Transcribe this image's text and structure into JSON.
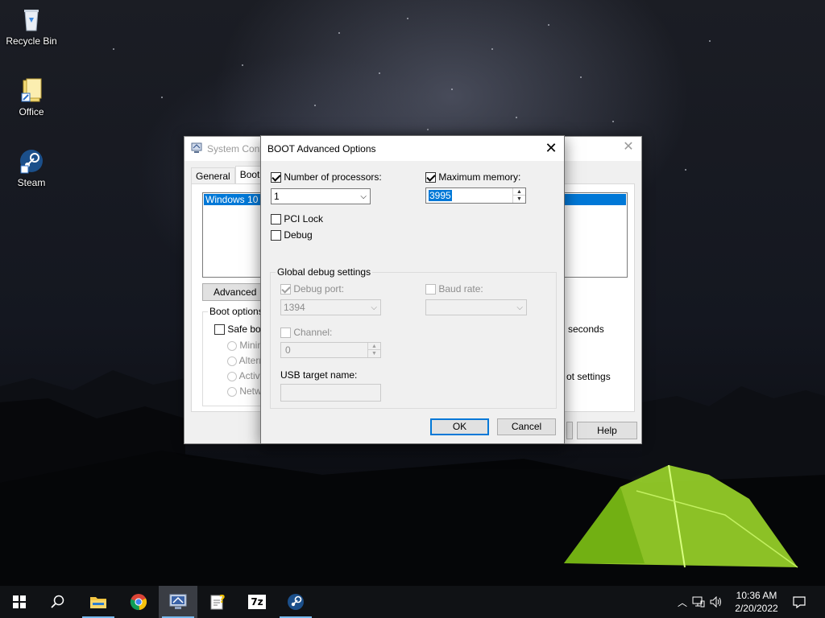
{
  "desktop": {
    "icons": [
      {
        "label": "Recycle Bin",
        "icon": "recycle-bin-icon"
      },
      {
        "label": "Office",
        "icon": "office-icon"
      },
      {
        "label": "Steam",
        "icon": "steam-icon"
      }
    ]
  },
  "sysconfig": {
    "title": "System Conf",
    "tabs": [
      "General",
      "Boot"
    ],
    "active_tab": "Boot",
    "os_entry": "Windows 10 (C",
    "advanced_button": "Advanced op",
    "boot_options_legend": "Boot options",
    "safe_boot_label": "Safe boo",
    "safe_boot_options": [
      "Minima",
      "Altern",
      "Active",
      "Netwo"
    ],
    "timeout_suffix": "seconds",
    "make_permanent_suffix": "ot settings",
    "help_button": "Help"
  },
  "dialog": {
    "title": "BOOT Advanced Options",
    "num_processors": {
      "label": "Number of processors:",
      "checked": true,
      "value": "1"
    },
    "max_memory": {
      "label": "Maximum memory:",
      "checked": true,
      "value": "3995"
    },
    "pci_lock": {
      "label": "PCI Lock",
      "checked": false
    },
    "debug": {
      "label": "Debug",
      "checked": false
    },
    "global_debug": {
      "legend": "Global debug settings",
      "debug_port": {
        "label": "Debug port:",
        "checked": true,
        "value": "1394"
      },
      "baud_rate": {
        "label": "Baud rate:",
        "checked": false,
        "value": ""
      },
      "channel": {
        "label": "Channel:",
        "checked": false,
        "value": "0"
      },
      "usb_target_label": "USB target name:",
      "usb_target_value": ""
    },
    "ok_button": "OK",
    "cancel_button": "Cancel"
  },
  "taskbar": {
    "items": [
      {
        "name": "start",
        "icon": "windows-logo-icon"
      },
      {
        "name": "search",
        "icon": "search-icon"
      },
      {
        "name": "file-explorer",
        "icon": "folder-icon",
        "running": true
      },
      {
        "name": "chrome",
        "icon": "chrome-icon"
      },
      {
        "name": "system-configuration",
        "icon": "msconfig-icon",
        "running": true,
        "active": true
      },
      {
        "name": "help-tool",
        "icon": "help-document-icon"
      },
      {
        "name": "7zip",
        "icon": "7zip-icon",
        "label": "7z"
      },
      {
        "name": "steam",
        "icon": "steam-icon",
        "running": true
      }
    ],
    "clock_time": "10:36 AM",
    "clock_date": "2/20/2022"
  },
  "colors": {
    "accent": "#0078d7",
    "taskbar": "#101215",
    "dialog_bg": "#f0f0f0"
  }
}
